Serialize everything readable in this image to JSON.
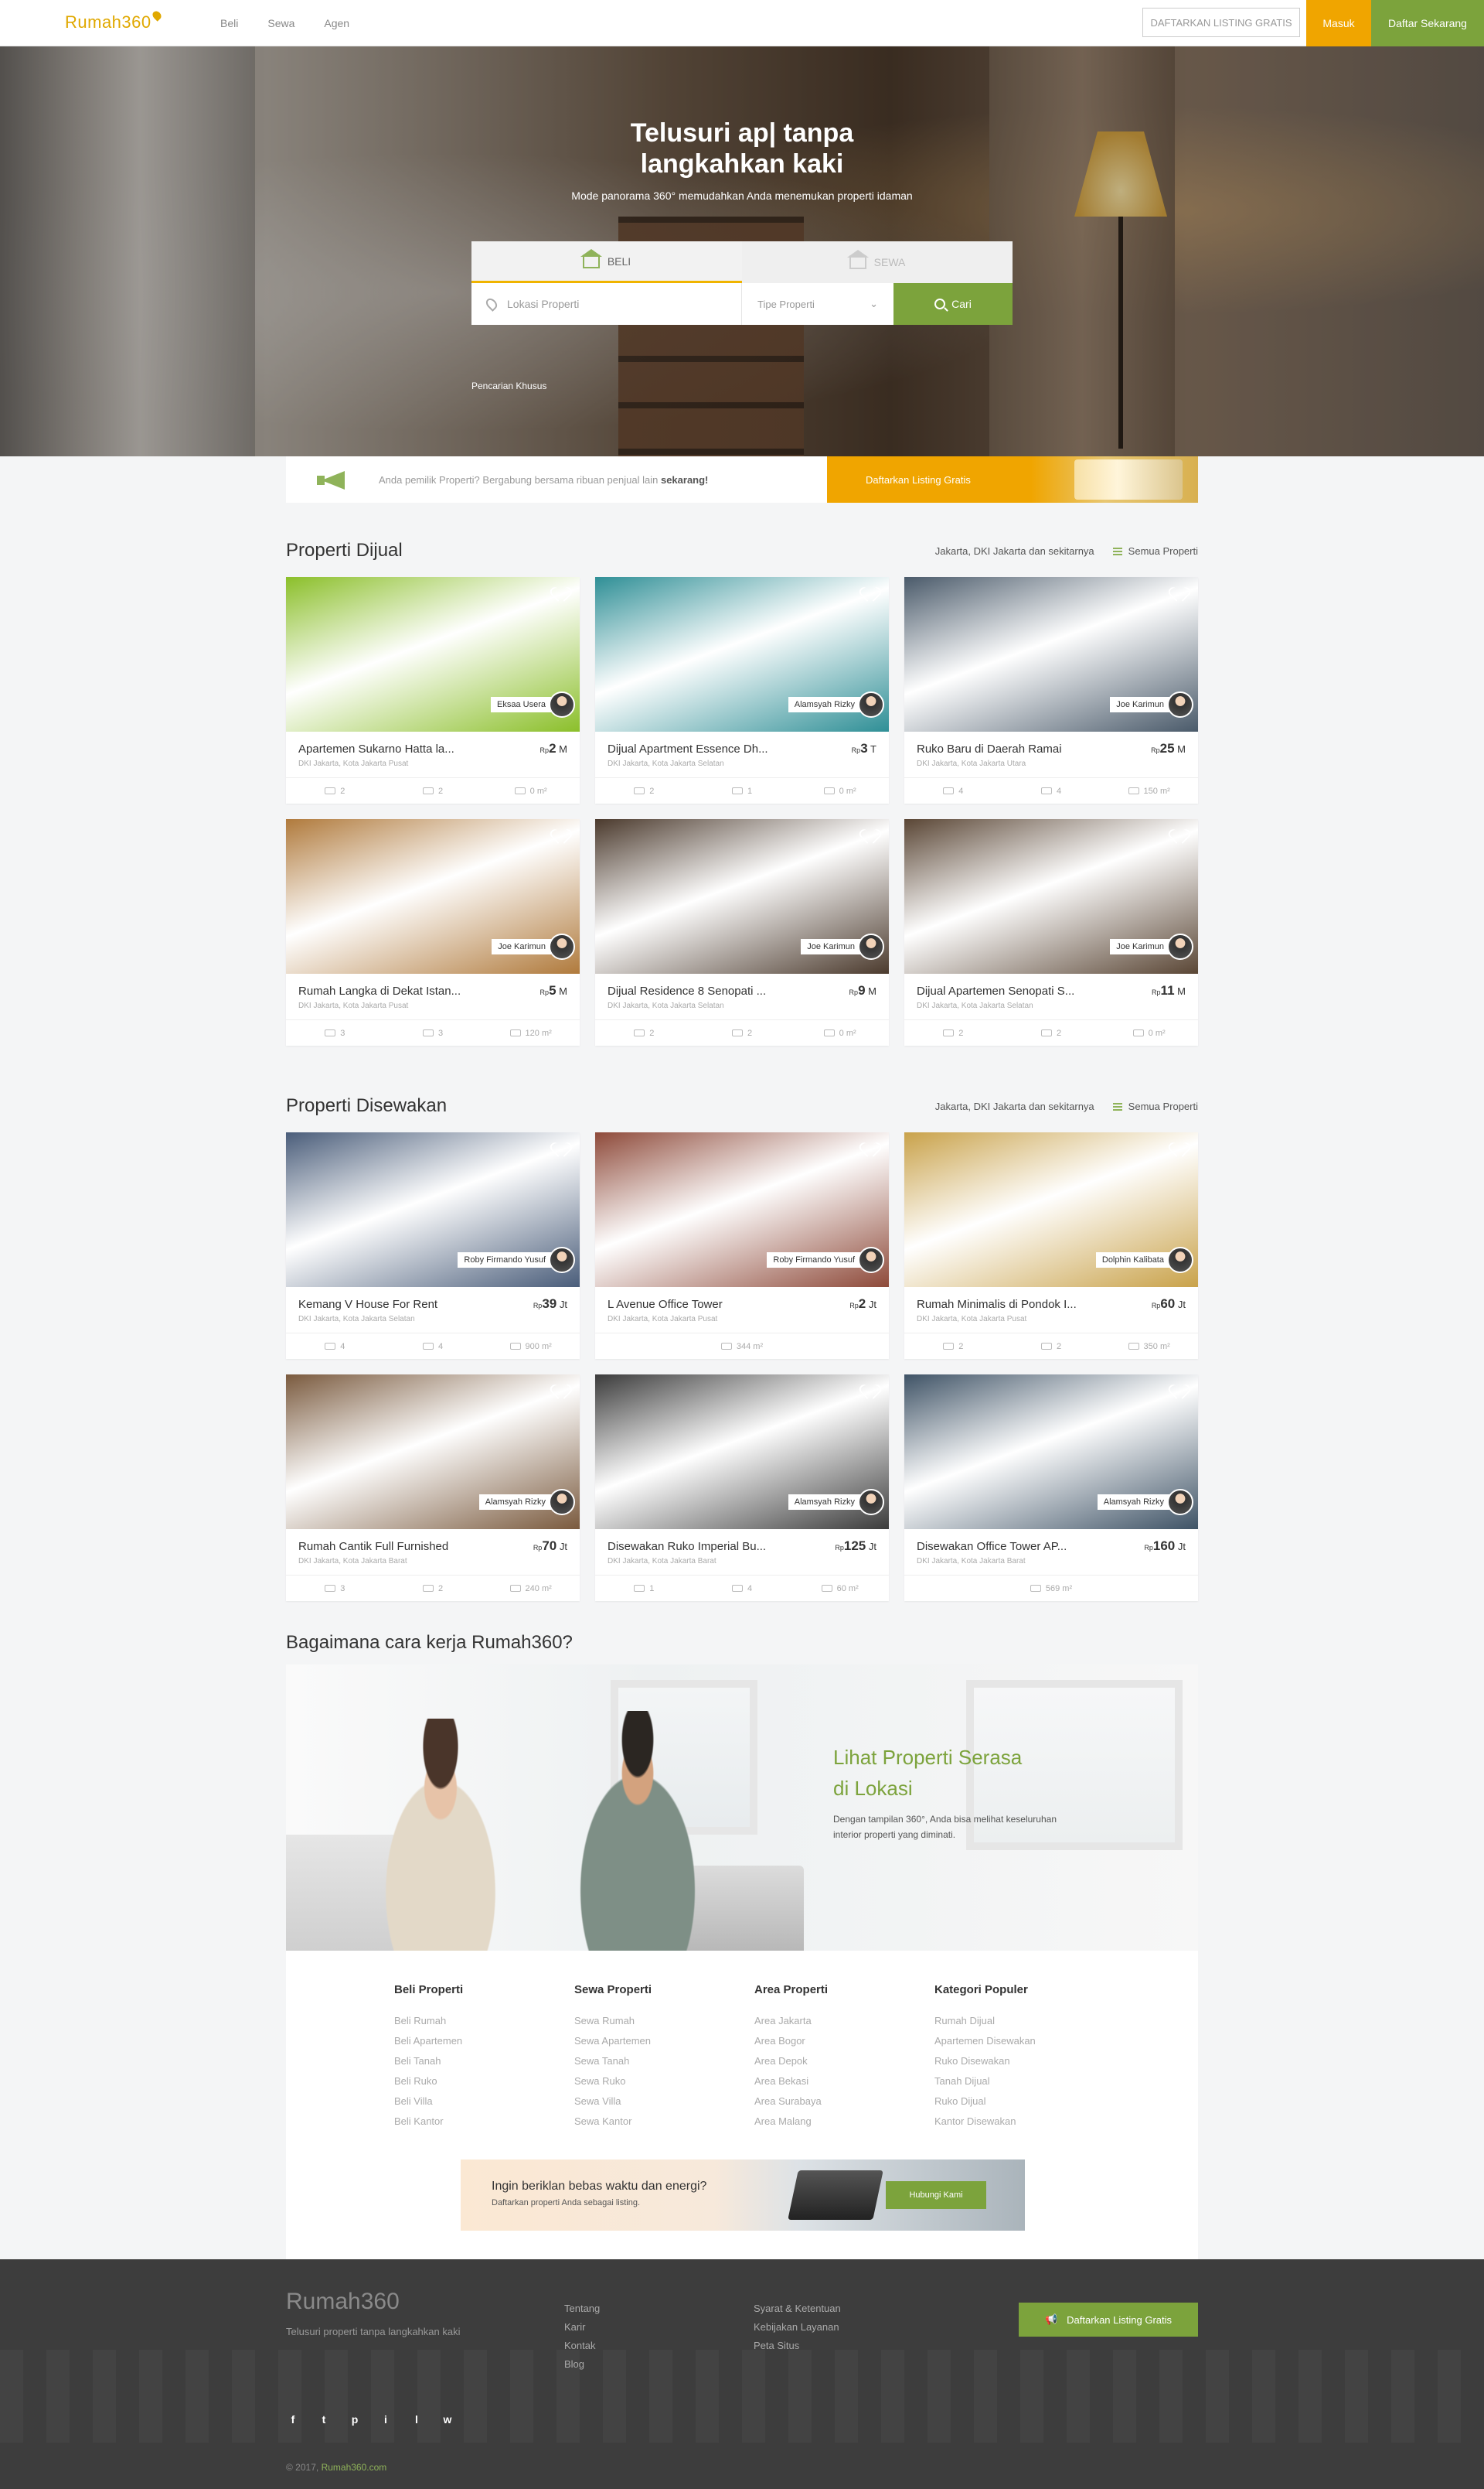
{
  "header": {
    "logo": "Rumah360",
    "nav": [
      "Beli",
      "Sewa",
      "Agen"
    ],
    "list_free": "DAFTARKAN LISTING GRATIS",
    "login": "Masuk",
    "signup": "Daftar Sekarang"
  },
  "hero": {
    "title_line1": "Telusuri ap| tanpa",
    "title_line2": "langkahkan kaki",
    "subtitle": "Mode panorama 360° memudahkan Anda menemukan properti idaman",
    "tabs": [
      "BELI",
      "SEWA"
    ],
    "location_placeholder": "Lokasi Properti",
    "type_placeholder": "Tipe Properti",
    "search_button": "Cari",
    "special_search": "Pencarian Khusus"
  },
  "owner_banner": {
    "text": "Anda pemilik Properti? Bergabung bersama ribuan penjual lain",
    "emphasis": "sekarang!",
    "button": "Daftarkan Listing Gratis"
  },
  "sale": {
    "title": "Properti Dijual",
    "location": "Jakarta, DKI Jakarta dan sekitarnya",
    "all": "Semua Properti",
    "cards": [
      {
        "title": "Apartemen Sukarno Hatta la...",
        "loc": "DKI Jakarta, Kota Jakarta Pusat",
        "price_prefix": "Rp",
        "price": "2",
        "unit": "M",
        "agent": "Eksaa Usera",
        "beds": "2",
        "baths": "2",
        "area": "0 m²",
        "bg": "#8bbf2a"
      },
      {
        "title": "Dijual Apartment Essence Dh...",
        "loc": "DKI Jakarta, Kota Jakarta Selatan",
        "price_prefix": "Rp",
        "price": "3",
        "unit": "T",
        "agent": "Alamsyah Rizky",
        "beds": "2",
        "baths": "1",
        "area": "0 m²",
        "bg": "#2f8f96"
      },
      {
        "title": "Ruko Baru di Daerah Ramai",
        "loc": "DKI Jakarta, Kota Jakarta Utara",
        "price_prefix": "Rp",
        "price": "25",
        "unit": "M",
        "agent": "Joe Karimun",
        "beds": "4",
        "baths": "4",
        "area": "150 m²",
        "bg": "#4a5a6a"
      },
      {
        "title": "Rumah Langka di Dekat Istan...",
        "loc": "DKI Jakarta, Kota Jakarta Pusat",
        "price_prefix": "Rp",
        "price": "5",
        "unit": "M",
        "agent": "Joe Karimun",
        "beds": "3",
        "baths": "3",
        "area": "120 m²",
        "bg": "#b07a3c"
      },
      {
        "title": "Dijual Residence 8 Senopati ...",
        "loc": "DKI Jakarta, Kota Jakarta Selatan",
        "price_prefix": "Rp",
        "price": "9",
        "unit": "M",
        "agent": "Joe Karimun",
        "beds": "2",
        "baths": "2",
        "area": "0 m²",
        "bg": "#4b3a2d"
      },
      {
        "title": "Dijual Apartemen Senopati S...",
        "loc": "DKI Jakarta, Kota Jakarta Selatan",
        "price_prefix": "Rp",
        "price": "11",
        "unit": "M",
        "agent": "Joe Karimun",
        "beds": "2",
        "baths": "2",
        "area": "0 m²",
        "bg": "#5a4635"
      }
    ]
  },
  "rent": {
    "title": "Properti Disewakan",
    "location": "Jakarta, DKI Jakarta dan sekitarnya",
    "all": "Semua Properti",
    "cards": [
      {
        "title": "Kemang V House For Rent",
        "loc": "DKI Jakarta, Kota Jakarta Selatan",
        "price_prefix": "Rp",
        "price": "39",
        "unit": "Jt",
        "agent": "Roby Firmando Yusuf",
        "beds": "4",
        "baths": "4",
        "area": "900 m²",
        "bg": "#4a5d7a"
      },
      {
        "title": "L Avenue Office Tower",
        "loc": "DKI Jakarta, Kota Jakarta Pusat",
        "price_prefix": "Rp",
        "price": "2",
        "unit": "Jt",
        "agent": "Roby Firmando Yusuf",
        "beds": "",
        "baths": "",
        "area": "344 m²",
        "bg": "#8e4a3a"
      },
      {
        "title": "Rumah Minimalis di Pondok I...",
        "loc": "DKI Jakarta, Kota Jakarta Pusat",
        "price_prefix": "Rp",
        "price": "60",
        "unit": "Jt",
        "agent": "Dolphin Kalibata",
        "beds": "2",
        "baths": "2",
        "area": "350 m²",
        "bg": "#c9a24a"
      },
      {
        "title": "Rumah Cantik Full Furnished",
        "loc": "DKI Jakarta, Kota Jakarta Barat",
        "price_prefix": "Rp",
        "price": "70",
        "unit": "Jt",
        "agent": "Alamsyah Rizky",
        "beds": "3",
        "baths": "2",
        "area": "240 m²",
        "bg": "#7a5a3e"
      },
      {
        "title": "Disewakan Ruko Imperial Bu...",
        "loc": "DKI Jakarta, Kota Jakarta Barat",
        "price_prefix": "Rp",
        "price": "125",
        "unit": "Jt",
        "agent": "Alamsyah Rizky",
        "beds": "1",
        "baths": "4",
        "area": "60 m²",
        "bg": "#3b3b3b"
      },
      {
        "title": "Disewakan Office Tower AP...",
        "loc": "DKI Jakarta, Kota Jakarta Barat",
        "price_prefix": "Rp",
        "price": "160",
        "unit": "Jt",
        "agent": "Alamsyah Rizky",
        "beds": "",
        "baths": "",
        "area": "569 m²",
        "bg": "#3f5366"
      }
    ]
  },
  "how": {
    "title": "Bagaimana cara kerja Rumah360?",
    "headline1": "Lihat Properti Serasa",
    "headline2": "di Lokasi",
    "desc": "Dengan tampilan 360°, Anda bisa melihat keseluruhan interior properti yang diminati."
  },
  "links": [
    {
      "heading": "Beli Properti",
      "items": [
        "Beli Rumah",
        "Beli Apartemen",
        "Beli Tanah",
        "Beli Ruko",
        "Beli Villa",
        "Beli Kantor"
      ]
    },
    {
      "heading": "Sewa Properti",
      "items": [
        "Sewa Rumah",
        "Sewa Apartemen",
        "Sewa Tanah",
        "Sewa Ruko",
        "Sewa Villa",
        "Sewa Kantor"
      ]
    },
    {
      "heading": "Area Properti",
      "items": [
        "Area Jakarta",
        "Area Bogor",
        "Area Depok",
        "Area Bekasi",
        "Area Surabaya",
        "Area Malang"
      ]
    },
    {
      "heading": "Kategori Populer",
      "items": [
        "Rumah Dijual",
        "Apartemen Disewakan",
        "Ruko Disewakan",
        "Tanah Dijual",
        "Ruko Dijual",
        "Kantor Disewakan"
      ]
    }
  ],
  "ads": {
    "title": "Ingin beriklan bebas waktu dan energi?",
    "sub": "Daftarkan properti Anda sebagai listing.",
    "button": "Hubungi Kami"
  },
  "footer": {
    "logo": "Rumah360",
    "tagline": "Telusuri properti tanpa langkahkan kaki",
    "col1": [
      "Tentang",
      "Karir",
      "Kontak",
      "Blog"
    ],
    "col2": [
      "Syarat & Ketentuan",
      "Kebijakan Layanan",
      "Peta Situs"
    ],
    "button": "Daftarkan Listing Gratis",
    "socials": [
      "f",
      "t",
      "p",
      "i",
      "l",
      "w"
    ],
    "copyright": "© 2017,",
    "site": "Rumah360.com"
  }
}
